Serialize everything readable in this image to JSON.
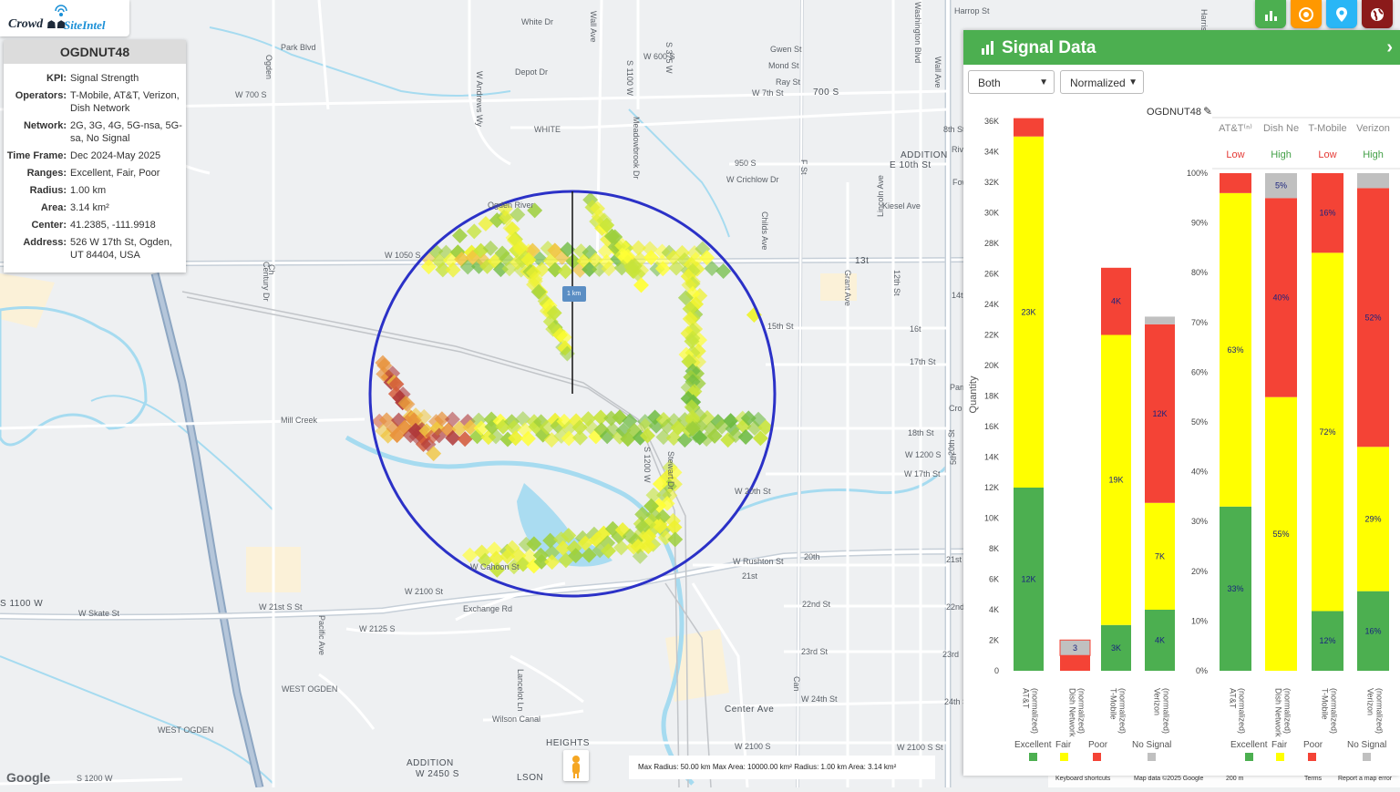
{
  "app": {
    "brand_left": "Crowd",
    "brand_right": "SiteIntel"
  },
  "info": {
    "title": "OGDNUT48",
    "rows": [
      {
        "k": "KPI:",
        "v": "Signal Strength"
      },
      {
        "k": "Operators:",
        "v": "T-Mobile, AT&T, Verizon, Dish Network"
      },
      {
        "k": "Network:",
        "v": "2G, 3G, 4G, 5G-nsa, 5G-sa, No Signal"
      },
      {
        "k": "Time Frame:",
        "v": "Dec 2024-May 2025"
      },
      {
        "k": "Ranges:",
        "v": "Excellent, Fair, Poor"
      },
      {
        "k": "Radius:",
        "v": "1.00 km"
      },
      {
        "k": "Area:",
        "v": "3.14 km²"
      },
      {
        "k": "Center:",
        "v": "41.2385, -111.9918"
      },
      {
        "k": "Address:",
        "v": "526 W 17th St, Ogden, UT 84404, USA"
      }
    ]
  },
  "top_buttons": [
    {
      "icon": "bar-chart-icon",
      "color": "#4caf50"
    },
    {
      "icon": "target-icon",
      "color": "#ff9800"
    },
    {
      "icon": "location-pin-icon",
      "color": "#29b6f6"
    },
    {
      "icon": "globe-icon",
      "color": "#8b1a1a"
    }
  ],
  "map": {
    "scale_label": "1 km",
    "street_labels": [
      "White Dr",
      "Gwen St",
      "Mond St",
      "Ray St",
      "W 7th St",
      "700 S",
      "Harrop St",
      "8th St",
      "W 700 S",
      "W 600 S",
      "S 375 W",
      "Meadowbrook Dr",
      "950 S",
      "W Crichlow Dr",
      "Depot Dr",
      "W Andrews Wy",
      "WHITE",
      "ADDITION",
      "E 10th St",
      "Kiesel Ave",
      "Washington Blvd",
      "Wall Ave",
      "F St",
      "Childs Ave",
      "Lincoln Ave",
      "Grant Ave",
      "12th St",
      "13t",
      "14th St",
      "15th St",
      "16t",
      "17th St",
      "Parry St",
      "18th St",
      "W 1200 S",
      "W 17th St",
      "W 1050 S",
      "Mill Creek",
      "Ogden River",
      "Park Blvd",
      "W 20th St",
      "20th St",
      "W Rushton St",
      "20th",
      "21st",
      "21st St",
      "22nd",
      "22nd St",
      "23rd",
      "23rd St",
      "24th St",
      "W 24th St",
      "W 2100 S St",
      "W 2100 S",
      "W 21st S St",
      "W 2100 St",
      "W Skate St",
      "W 2125 S",
      "Exchange Rd",
      "W Cahoon St",
      "Lancelot Ln",
      "Wilson Canal",
      "WEST OGDEN",
      "WEST OGDEN",
      "HEIGHTS",
      "ADDITION",
      "W 2450 S",
      "LSON",
      "S 1200 W",
      "S 1100 W",
      "Ogden",
      "Pacific Ave",
      "Center Ave",
      "S 1200 W",
      "Stewart Dr",
      "Century Dr",
      "Wall Ave",
      "S 1100 W",
      "Can",
      "Ch",
      "Cro",
      "Rive",
      "Fowle",
      "5th",
      "Harrisor"
    ],
    "bottom_bar": "Max Radius: 50.00 km  Max Area: 10000.00 km²  Radius: 1.00 km  Area: 3.14 km²",
    "attribution": [
      "Keyboard shortcuts",
      "Map data ©2025 Google",
      "200 m",
      "Terms",
      "Report a map error"
    ],
    "google": "Google"
  },
  "panel": {
    "title": "Signal Data",
    "select_operator": "Both",
    "select_mode": "Normalized",
    "chart_title": "OGDNUT48"
  },
  "chart_data": [
    {
      "type": "bar",
      "stacked": true,
      "title": "OGDNUT48",
      "ylabel": "Quantity",
      "ylim": [
        0,
        36000
      ],
      "yticks": [
        "0",
        "2K",
        "4K",
        "6K",
        "8K",
        "10K",
        "12K",
        "14K",
        "16K",
        "18K",
        "20K",
        "22K",
        "24K",
        "26K",
        "28K",
        "30K",
        "32K",
        "34K",
        "36K"
      ],
      "categories": [
        "AT&T (normalized)",
        "Dish Network (normalized)",
        "T-Mobile (normalized)",
        "Verizon (normalized)"
      ],
      "series": [
        {
          "name": "Excellent",
          "color": "#4caf50",
          "values": [
            12000,
            0,
            3000,
            4000
          ],
          "labels": [
            "12K",
            "",
            "3K",
            "4K"
          ]
        },
        {
          "name": "Fair",
          "color": "#ffff00",
          "values": [
            23000,
            0,
            19000,
            7000
          ],
          "labels": [
            "23K",
            "",
            "19K",
            "7K"
          ]
        },
        {
          "name": "Poor",
          "color": "#f44336",
          "values": [
            1200,
            1000,
            4400,
            11700
          ],
          "labels": [
            "",
            "",
            "4K",
            "12K"
          ]
        },
        {
          "name": "No Signal",
          "color": "#c0c0c0",
          "values": [
            0,
            3,
            0,
            500
          ],
          "labels": [
            "",
            "3",
            "",
            ""
          ]
        }
      ]
    },
    {
      "type": "bar",
      "stacked": true,
      "ylim": [
        0,
        100
      ],
      "yticks": [
        "0%",
        "10%",
        "20%",
        "30%",
        "40%",
        "50%",
        "60%",
        "70%",
        "80%",
        "90%",
        "100%"
      ],
      "categories": [
        "AT&T (normalized)",
        "Dish Network (normalized)",
        "T-Mobile (normalized)",
        "Verizon (normalized)"
      ],
      "column_headers": [
        "AT&T⁽ⁿ⁾",
        "Dish Ne",
        "T-Mobile",
        "Verizon"
      ],
      "ratings": [
        "Low",
        "High",
        "Low",
        "High"
      ],
      "series": [
        {
          "name": "Excellent",
          "color": "#4caf50",
          "values": [
            33,
            0,
            12,
            16
          ],
          "labels": [
            "33%",
            "",
            "12%",
            "16%"
          ]
        },
        {
          "name": "Fair",
          "color": "#ffff00",
          "values": [
            63,
            55,
            72,
            29
          ],
          "labels": [
            "63%",
            "55%",
            "72%",
            "29%"
          ]
        },
        {
          "name": "Poor",
          "color": "#f44336",
          "values": [
            4,
            40,
            16,
            52
          ],
          "labels": [
            "",
            "40%",
            "16%",
            "52%"
          ]
        },
        {
          "name": "No Signal",
          "color": "#c0c0c0",
          "values": [
            0,
            5,
            0,
            3
          ],
          "labels": [
            "",
            "5%",
            "",
            ""
          ]
        }
      ]
    }
  ],
  "legend": [
    "Excellent",
    "Fair",
    "Poor",
    "No Signal"
  ]
}
